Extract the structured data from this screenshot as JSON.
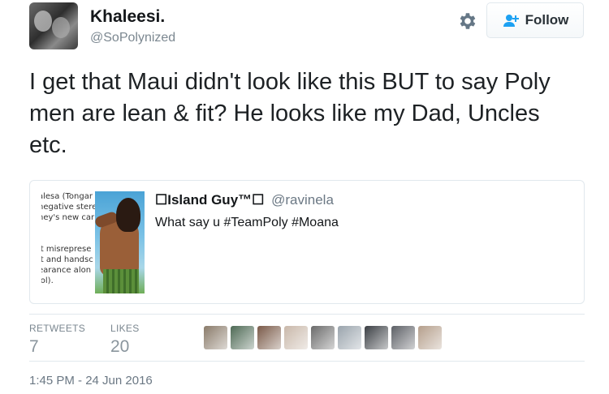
{
  "author": {
    "name": "Khaleesi.",
    "handle": "@SoPolynized"
  },
  "follow_button": {
    "label": "Follow"
  },
  "tweet": {
    "text": "I get that Maui didn't look like this BUT to say Poly men are lean & fit? He looks like my Dad, Uncles etc."
  },
  "quoted_tweet": {
    "name": "☐Island Guy™☐",
    "handle": "@ravinela",
    "text": "What say u #TeamPoly #Moana",
    "side_text": [
      "alesa (Tongar",
      "negative stere",
      "hey's new car",
      "",
      "",
      "it misreprese",
      "it and handsc",
      "earance alon",
      "lol)."
    ]
  },
  "stats": {
    "retweets_label": "RETWEETS",
    "retweets_count": "7",
    "likes_label": "LIKES",
    "likes_count": "20"
  },
  "likers": [
    {
      "icon": "liker-avatar",
      "color": "#8a7b6a"
    },
    {
      "icon": "liker-avatar",
      "color": "#4e6a55"
    },
    {
      "icon": "liker-avatar",
      "color": "#7a5a48"
    },
    {
      "icon": "liker-avatar",
      "color": "#c9b8aa"
    },
    {
      "icon": "liker-avatar",
      "color": "#6b6b6b"
    },
    {
      "icon": "liker-avatar",
      "color": "#9aa4ad"
    },
    {
      "icon": "liker-avatar",
      "color": "#3b3f44"
    },
    {
      "icon": "liker-avatar",
      "color": "#5d6066"
    },
    {
      "icon": "liker-avatar",
      "color": "#b59f8c"
    }
  ],
  "timestamp": "1:45 PM - 24 Jun 2016",
  "colors": {
    "follow_icon": "#1da1f2",
    "muted_text": "#7b8790"
  }
}
